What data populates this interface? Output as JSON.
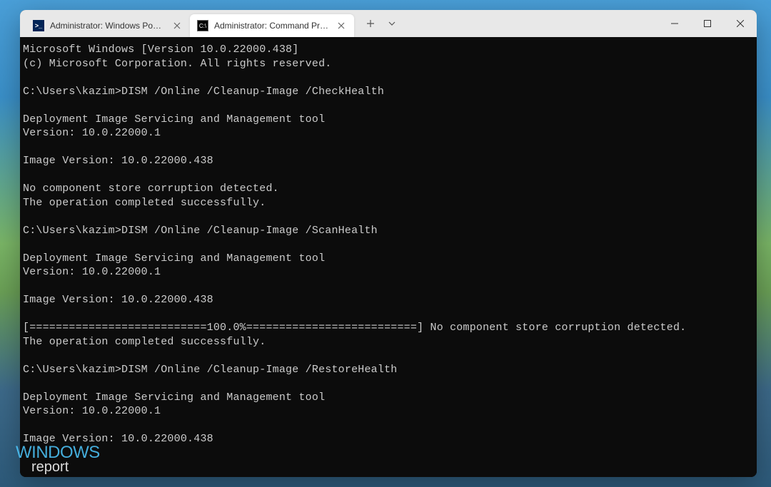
{
  "window": {
    "tabs": [
      {
        "title": "Administrator: Windows PowerS",
        "type": "powershell",
        "active": false
      },
      {
        "title": "Administrator: Command Promp",
        "type": "cmd",
        "active": true
      }
    ]
  },
  "terminal": {
    "lines": [
      "Microsoft Windows [Version 10.0.22000.438]",
      "(c) Microsoft Corporation. All rights reserved.",
      "",
      "C:\\Users\\kazim>DISM /Online /Cleanup-Image /CheckHealth",
      "",
      "Deployment Image Servicing and Management tool",
      "Version: 10.0.22000.1",
      "",
      "Image Version: 10.0.22000.438",
      "",
      "No component store corruption detected.",
      "The operation completed successfully.",
      "",
      "C:\\Users\\kazim>DISM /Online /Cleanup-Image /ScanHealth",
      "",
      "Deployment Image Servicing and Management tool",
      "Version: 10.0.22000.1",
      "",
      "Image Version: 10.0.22000.438",
      "",
      "[===========================100.0%==========================] No component store corruption detected.",
      "The operation completed successfully.",
      "",
      "C:\\Users\\kazim>DISM /Online /Cleanup-Image /RestoreHealth",
      "",
      "Deployment Image Servicing and Management tool",
      "Version: 10.0.22000.1",
      "",
      "Image Version: 10.0.22000.438",
      ""
    ]
  },
  "watermark": {
    "line1": "WINDOWS",
    "line2": "report"
  }
}
